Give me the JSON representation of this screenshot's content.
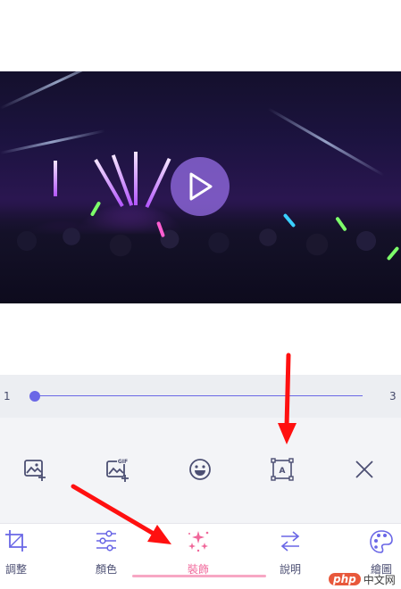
{
  "slider": {
    "min_label": "1",
    "max_label": "3",
    "value": 1
  },
  "tools": [
    {
      "icon": "image-add-icon"
    },
    {
      "icon": "gif-add-icon"
    },
    {
      "icon": "emoji-icon"
    },
    {
      "icon": "text-box-icon"
    },
    {
      "icon": "close-icon"
    }
  ],
  "tabs": [
    {
      "label": "調整",
      "icon": "crop-icon",
      "active": false
    },
    {
      "label": "顏色",
      "icon": "sliders-icon",
      "active": false
    },
    {
      "label": "裝飾",
      "icon": "sparkles-icon",
      "active": true
    },
    {
      "label": "說明",
      "icon": "swap-arrows-icon",
      "active": false
    },
    {
      "label": "繪圖",
      "icon": "palette-icon",
      "active": false
    }
  ],
  "colors": {
    "accent": "#6a67e6",
    "active_tab": "#f0679a",
    "icon": "#4c4f73",
    "annotation_arrow": "#ff1010"
  },
  "watermark": {
    "logo": "php",
    "text": "中文网"
  }
}
